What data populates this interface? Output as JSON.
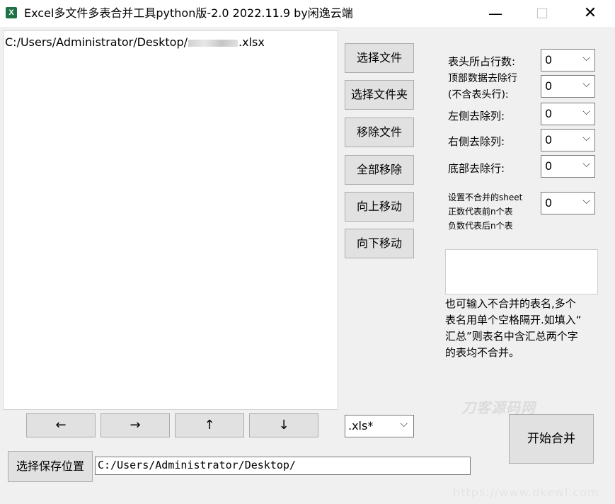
{
  "window": {
    "title": "Excel多文件多表合并工具python版-2.0 2022.11.9 by闲逸云端",
    "minimize": "—",
    "maximize": "☐",
    "close": "✕"
  },
  "file_list": {
    "items": [
      {
        "prefix": "C:/Users/Administrator/Desktop/",
        "suffix": ".xlsx"
      }
    ]
  },
  "side_buttons": {
    "select_file": "选择文件",
    "select_folder": "选择文件夹",
    "remove_file": "移除文件",
    "remove_all": "全部移除",
    "move_up": "向上移动",
    "move_down": "向下移动"
  },
  "settings": {
    "header_rows": {
      "label": "表头所占行数:",
      "value": "0"
    },
    "top_remove": {
      "label_line1": "顶部数据去除行",
      "label_line2": "(不含表头行):",
      "value": "0"
    },
    "left_remove": {
      "label": "左侧去除列:",
      "value": "0"
    },
    "right_remove": {
      "label": "右侧去除列:",
      "value": "0"
    },
    "bottom_remove": {
      "label": "底部去除行:",
      "value": "0"
    },
    "sheet_exclude": {
      "label_line1": "设置不合并的sheet",
      "label_line2": "正数代表前n个表",
      "label_line3": "负数代表后n个表",
      "value": "0"
    },
    "exclude_names_value": "",
    "hint_line1": "也可输入不合并的表名,多个",
    "hint_line2": "表名用单个空格隔开.如填入“",
    "hint_line3": "汇总”则表名中含汇总两个字",
    "hint_line4": "的表均不合并。"
  },
  "arrow_buttons": {
    "left": "←",
    "right": "→",
    "up": "↑",
    "down": "↓"
  },
  "extension": {
    "value": ".xls*"
  },
  "merge_button": "开始合并",
  "save": {
    "button": "选择保存位置",
    "path": "C:/Users/Administrator/Desktop/"
  },
  "watermark": {
    "text": "刀客源码网",
    "url": "https://www.dkewl.com"
  },
  "chevron": "⌵"
}
